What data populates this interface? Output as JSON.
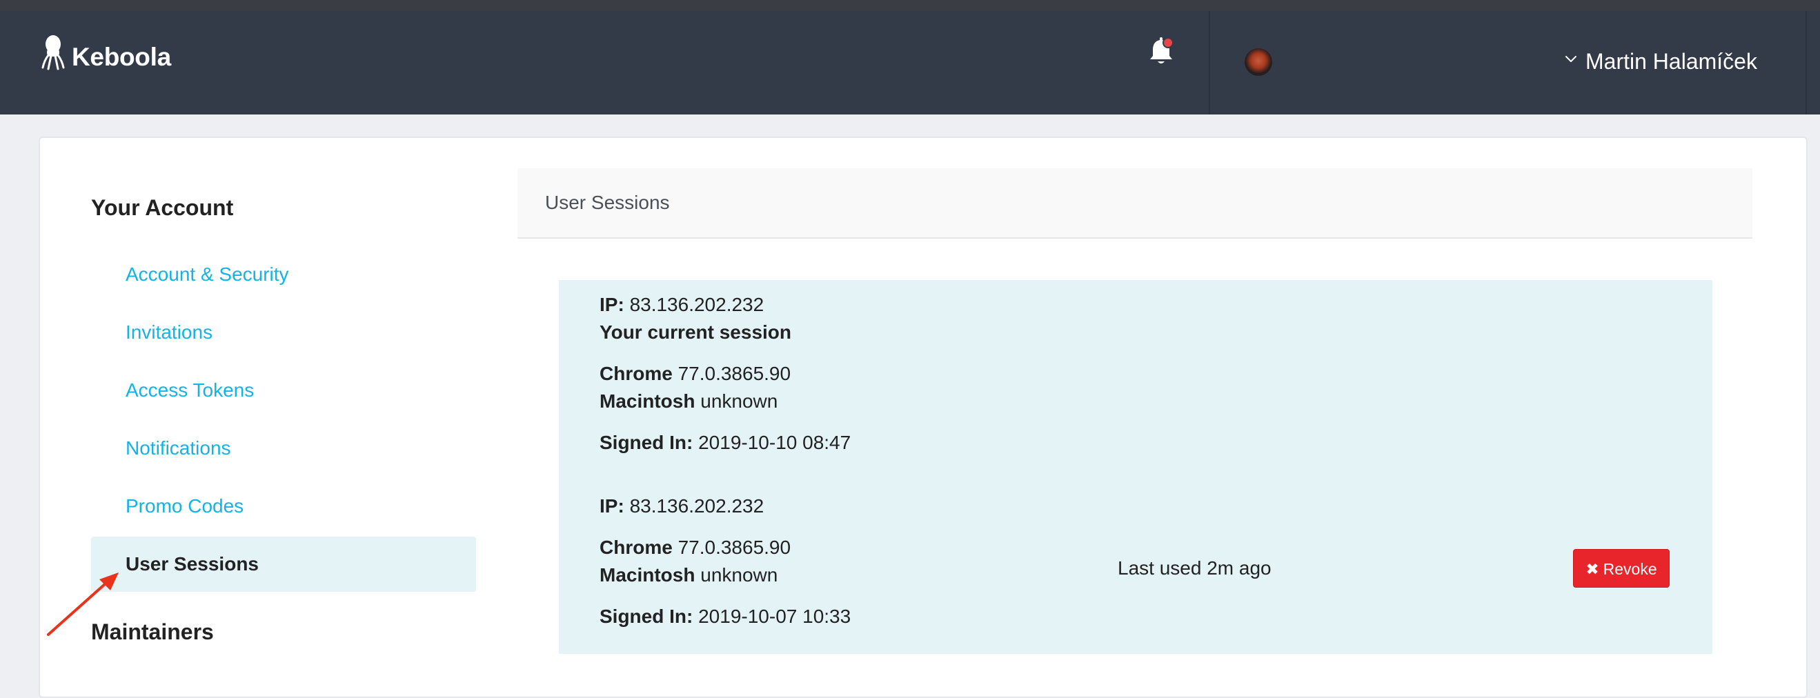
{
  "header": {
    "brand": "Keboola",
    "user_name": "Martin Halamíček",
    "notification_color": "#e8454b",
    "icons": [
      "octopus-logo-icon",
      "bell-icon",
      "avatar",
      "chevron-down-icon"
    ]
  },
  "sidebar": {
    "heading": "Your Account",
    "items": [
      {
        "label": "Account & Security"
      },
      {
        "label": "Invitations"
      },
      {
        "label": "Access Tokens"
      },
      {
        "label": "Notifications"
      },
      {
        "label": "Promo Codes"
      },
      {
        "label": "User Sessions",
        "active": true
      }
    ],
    "heading2": "Maintainers"
  },
  "panel": {
    "title": "User Sessions"
  },
  "sessions": [
    {
      "ip_label": "IP:",
      "ip": "83.136.202.232",
      "current": "Your current session",
      "browser": "Chrome",
      "browser_version": "77.0.3865.90",
      "os": "Macintosh",
      "os_version": "unknown",
      "signed_label": "Signed In:",
      "signed_in": "2019-10-10 08:47"
    },
    {
      "ip_label": "IP:",
      "ip": "83.136.202.232",
      "browser": "Chrome",
      "browser_version": "77.0.3865.90",
      "os": "Macintosh",
      "os_version": "unknown",
      "signed_label": "Signed In:",
      "signed_in": "2019-10-07 10:33",
      "last_used": "Last used 2m ago",
      "revoke_label": "Revoke"
    }
  ],
  "colors": {
    "header_bg": "#333a48",
    "link": "#14b3e6",
    "session_bg": "#e4f3f6",
    "revoke_bg": "#e8252b"
  }
}
